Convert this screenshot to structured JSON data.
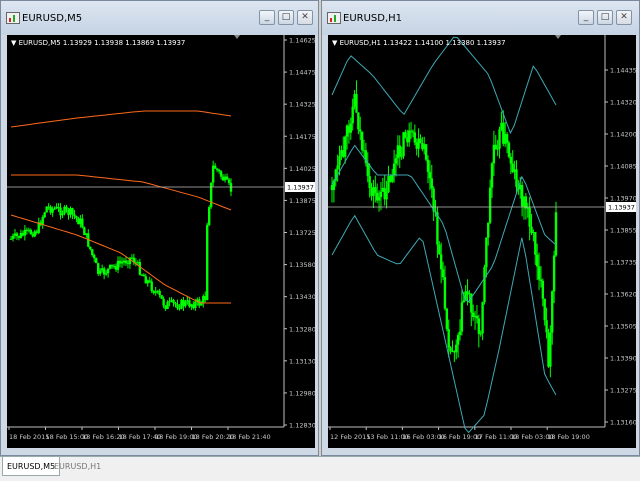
{
  "windows": [
    {
      "title": "EURUSD,M5",
      "legend": "EURUSD,M5  1.13929 1.13938 1.13869 1.13937",
      "price_labels": [
        "1.14625",
        "1.14475",
        "1.14325",
        "1.14175",
        "1.14025",
        "1.13875",
        "1.13725",
        "1.13580",
        "1.13430",
        "1.13280",
        "1.13130",
        "1.12980",
        "1.12830"
      ],
      "current_price": "1.13937",
      "time_labels": [
        "18 Feb 2015",
        "18 Feb 15:00",
        "18 Feb 16:20",
        "18 Feb 17:40",
        "18 Feb 19:00",
        "18 Feb 20:20",
        "18 Feb 21:40"
      ]
    },
    {
      "title": "EURUSD,H1",
      "legend": "EURUSD,H1  1.13422 1.14100 1.13380 1.13937",
      "price_labels": [
        "1.14435",
        "1.14320",
        "1.14200",
        "1.14085",
        "1.13970",
        "1.13855",
        "1.13735",
        "1.13620",
        "1.13505",
        "1.13390",
        "1.13275",
        "1.13160"
      ],
      "current_price": "1.13937",
      "time_labels": [
        "12 Feb 2015",
        "13 Feb 11:00",
        "16 Feb 03:00",
        "16 Feb 19:00",
        "17 Feb 11:00",
        "18 Feb 03:00",
        "18 Feb 19:00"
      ]
    }
  ],
  "window_buttons": {
    "minimize": "_",
    "maximize": "□",
    "close": "✕"
  },
  "tabs": [
    "EURUSD,M5",
    "EURUSD,H1"
  ],
  "colors": {
    "chart_bg": "#000000",
    "candles": "#00ff00",
    "ma": "#ff6a1a",
    "bands": "#3fa9b5",
    "current_line": "#c0c0c0"
  },
  "icons": [
    "chart-window-icon",
    "minimize-icon",
    "maximize-icon",
    "close-icon",
    "legend-arrow-icon"
  ]
}
